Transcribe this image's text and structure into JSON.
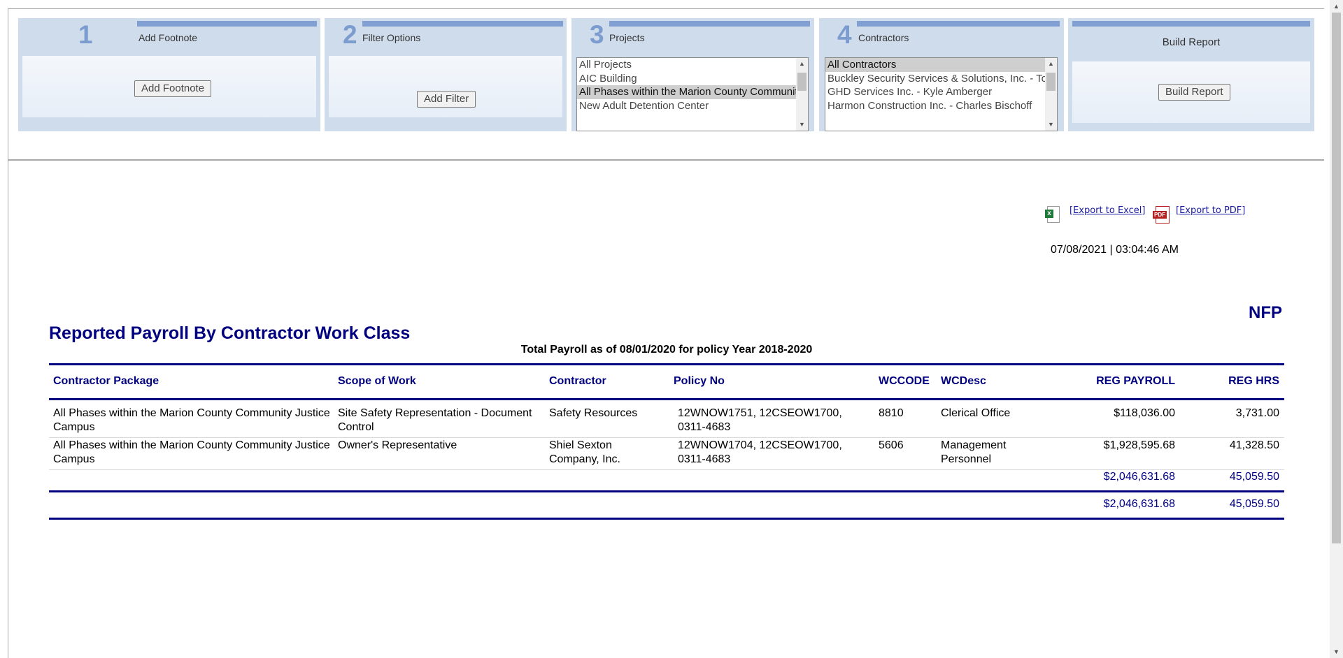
{
  "steps": [
    {
      "number": "1",
      "title": "Add Footnote",
      "button": "Add Footnote"
    },
    {
      "number": "2",
      "title": "Filter Options",
      "button": "Add Filter"
    },
    {
      "number": "3",
      "title": "Projects"
    },
    {
      "number": "4",
      "title": "Contractors"
    },
    {
      "number": "",
      "title": "Build Report",
      "button": "Build Report"
    }
  ],
  "projects_list": [
    "All Projects",
    "AIC Building",
    "All Phases within the Marion County Community Justice Campus",
    "New Adult Detention Center"
  ],
  "contractors_list": [
    "All Contractors",
    "Buckley Security Services & Solutions, Inc. - Tom",
    "GHD Services Inc. - Kyle Amberger",
    "Harmon Construction Inc. - Charles Bischoff"
  ],
  "export": {
    "excel": "[Export to Excel]",
    "pdf": "[Export to PDF]",
    "excel_icon": "excel-file-icon",
    "pdf_icon": "pdf-file-icon"
  },
  "timestamp": "07/08/2021 | 03:04:46 AM",
  "brand": "NFP",
  "report": {
    "title": "Reported Payroll By Contractor Work Class",
    "subtitle": "Total Payroll as of 08/01/2020 for policy Year 2018-2020",
    "columns": [
      "Contractor Package",
      "Scope of Work",
      "Contractor",
      "Policy No",
      "WCCODE",
      "WCDesc",
      "REG PAYROLL",
      "REG HRS"
    ],
    "rows": [
      {
        "package": "All Phases within the Marion County Community Justice Campus",
        "scope": "Site Safety Representation - Document Control",
        "contractor": "Safety Resources",
        "policy": "12WNOW1751, 12CSEOW1700, 0311-4683",
        "wccode": "8810",
        "wcdesc": "Clerical Office",
        "payroll": "$118,036.00",
        "hrs": "3,731.00"
      },
      {
        "package": "All Phases within the Marion County Community Justice Campus",
        "scope": "Owner's Representative",
        "contractor": "Shiel Sexton Company, Inc.",
        "policy": "12WNOW1704, 12CSEOW1700, 0311-4683",
        "wccode": "5606",
        "wcdesc": "Management Personnel",
        "payroll": "$1,928,595.68",
        "hrs": "41,328.50"
      }
    ],
    "subtotal": {
      "payroll": "$2,046,631.68",
      "hrs": "45,059.50"
    },
    "grand_total": {
      "payroll": "$2,046,631.68",
      "hrs": "45,059.50"
    }
  },
  "colors": {
    "accent": "#000080",
    "panel": "#cfdcec",
    "panel_bar": "#819fd3"
  }
}
